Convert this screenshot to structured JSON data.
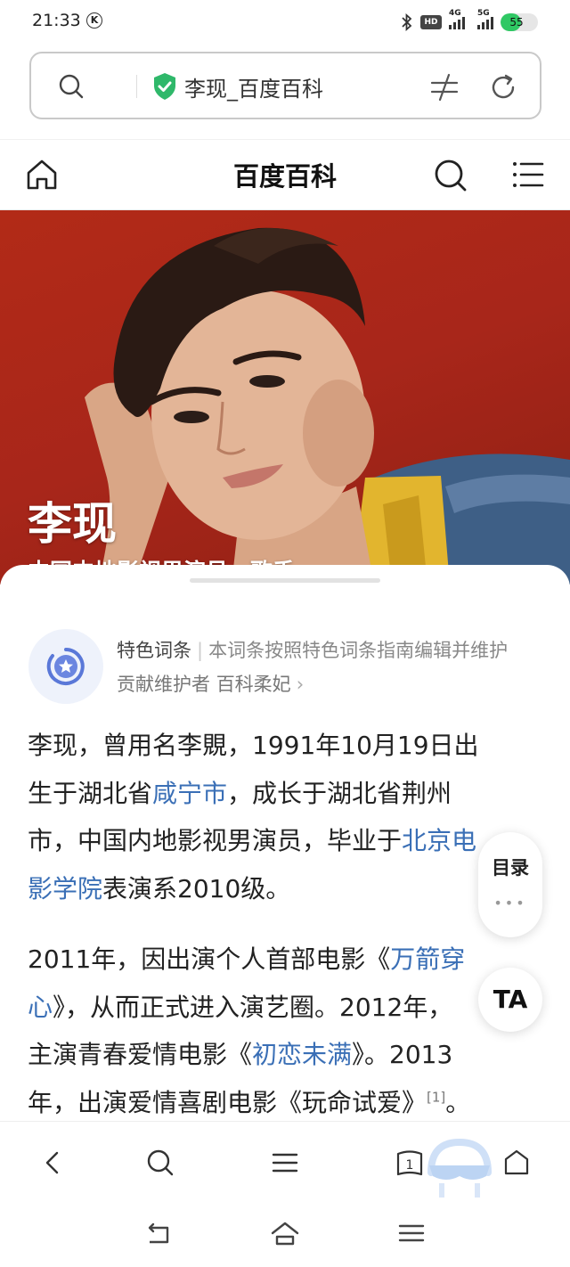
{
  "status_bar": {
    "time": "21:33",
    "k_badge": "K",
    "hd_label": "HD",
    "net1": "4G",
    "net2": "5G",
    "battery": "55",
    "battery_level": 0.55,
    "battery_color": "#2fc864"
  },
  "address_bar": {
    "url_title": "李现_百度百科",
    "secure_color": "#2fb86a"
  },
  "site_header": {
    "title": "百度百科"
  },
  "hero": {
    "name": "李现",
    "subtitle": "中国内地影视男演员、歌手"
  },
  "feature": {
    "label": "特色词条",
    "separator": "|",
    "description": "本词条按照特色词条指南编辑并维护",
    "contributor_prefix": "贡献维护者",
    "contributor_name": "百科柔妃",
    "chevron": "›"
  },
  "body": {
    "p1": {
      "l1": "李现，曾用名李覞，1991年10月19日出",
      "l2_a": "生于湖北省",
      "l2_link": "咸宁市",
      "l2_b": "，成长于湖北省荆州",
      "l3_a": "市，中国内地影视男演员，毕业于",
      "l3_link": "北京电",
      "l4_link": "影学院",
      "l4_b": "表演系2010级。"
    },
    "p2": {
      "l1_a": "2011年，因出演个人首部电影《",
      "l1_link": "万箭穿",
      "l2_link": "心",
      "l2_b": "》，从而正式进入演艺圈。2012年，",
      "l3_a": "主演青春爱情电影《",
      "l3_link": "初恋未满",
      "l3_b": "》。2013",
      "l4_a": "年，出演爱情喜剧电影《玩命试爱》",
      "l4_sup": "[1]",
      "l4_b": "。"
    },
    "link_color": "#3a6fb6"
  },
  "floating": {
    "toc_label": "目录",
    "toc_dots": "•••",
    "ta_label": "TA"
  },
  "toolbar": {
    "tabs_count": "1"
  }
}
